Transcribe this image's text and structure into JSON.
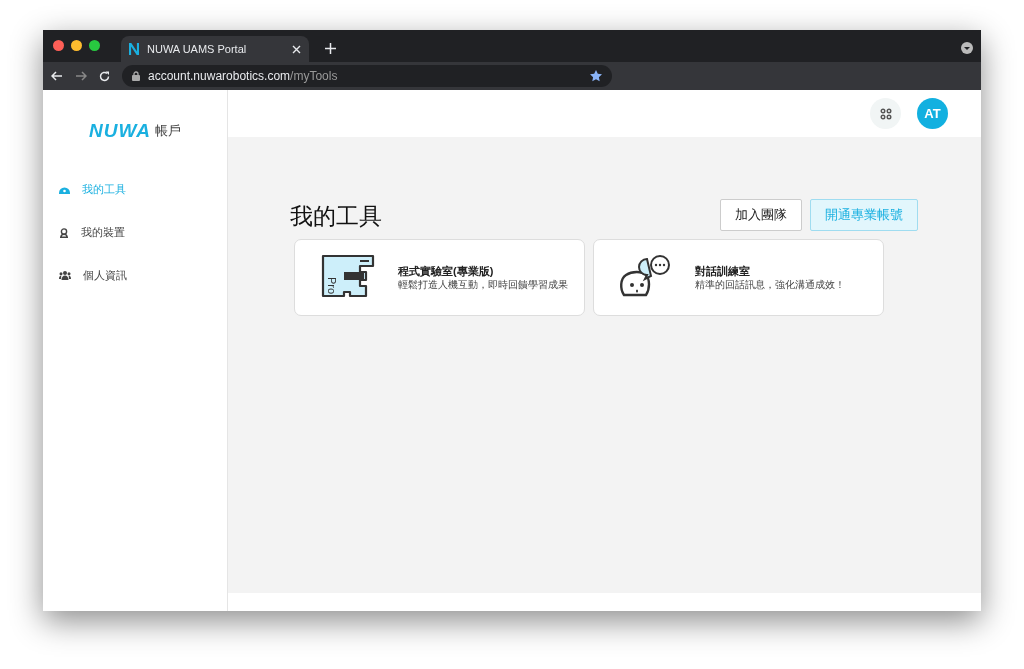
{
  "browser": {
    "tab_title": "NUWA UAMS Portal",
    "url_host": "account.nuwarobotics.com",
    "url_path": "/myTools"
  },
  "sidebar": {
    "logo": "NUWA",
    "logo_suffix": "帳戶",
    "items": [
      {
        "label": "我的工具",
        "selected": true,
        "kind": "tools"
      },
      {
        "label": "我的裝置",
        "selected": false,
        "kind": "device"
      },
      {
        "label": "個人資訊",
        "selected": false,
        "kind": "people"
      }
    ]
  },
  "header": {
    "avatar": "AT"
  },
  "page": {
    "title": "我的工具",
    "buttons": [
      {
        "label": "加入團隊",
        "kind": "outline"
      },
      {
        "label": "開通專業帳號",
        "kind": "primary"
      }
    ],
    "tools": [
      {
        "kind": "code_lab",
        "name": "程式實驗室(專業版)",
        "description": "輕鬆打造人機互動，即時回饋學習成果",
        "icon_label": "Pro"
      },
      {
        "kind": "chat",
        "name": "對話訓練室",
        "description": "精準的回話訊息，強化溝通成效！"
      }
    ]
  }
}
